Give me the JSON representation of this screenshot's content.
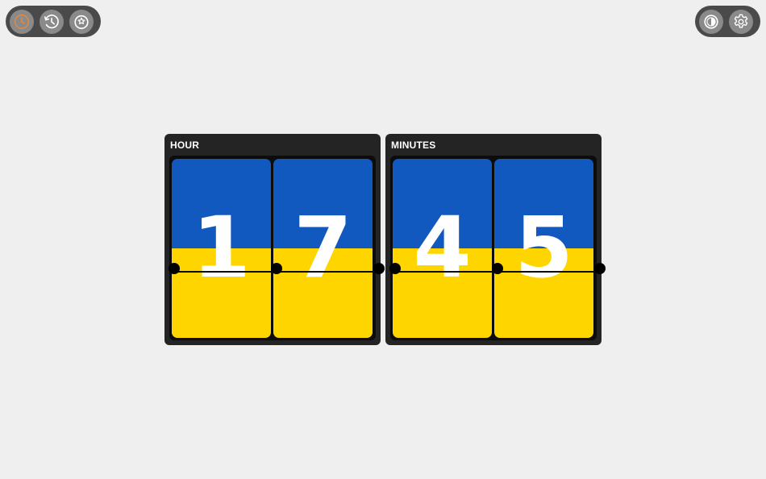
{
  "toolbar_left": {
    "items": [
      {
        "name": "clock",
        "icon": "clock-icon",
        "active": true
      },
      {
        "name": "timer",
        "icon": "history-clock-icon",
        "active": false
      },
      {
        "name": "stopwatch",
        "icon": "stopwatch-icon",
        "active": false
      }
    ]
  },
  "toolbar_right": {
    "items": [
      {
        "name": "theme",
        "icon": "contrast-icon"
      },
      {
        "name": "settings",
        "icon": "gear-icon"
      }
    ]
  },
  "clock": {
    "hour": {
      "label": "HOUR",
      "digits": [
        "1",
        "7"
      ]
    },
    "minutes": {
      "label": "MINUTES",
      "digits": [
        "4",
        "5"
      ]
    }
  },
  "colors": {
    "background": "#efefef",
    "toolbar": "#4a4a4a",
    "button": "#8a8a8a",
    "active_icon": "#e8893a",
    "panel": "#242424",
    "card_top": "#1158bf",
    "card_bottom": "#ffd500",
    "digit": "#ffffff"
  }
}
